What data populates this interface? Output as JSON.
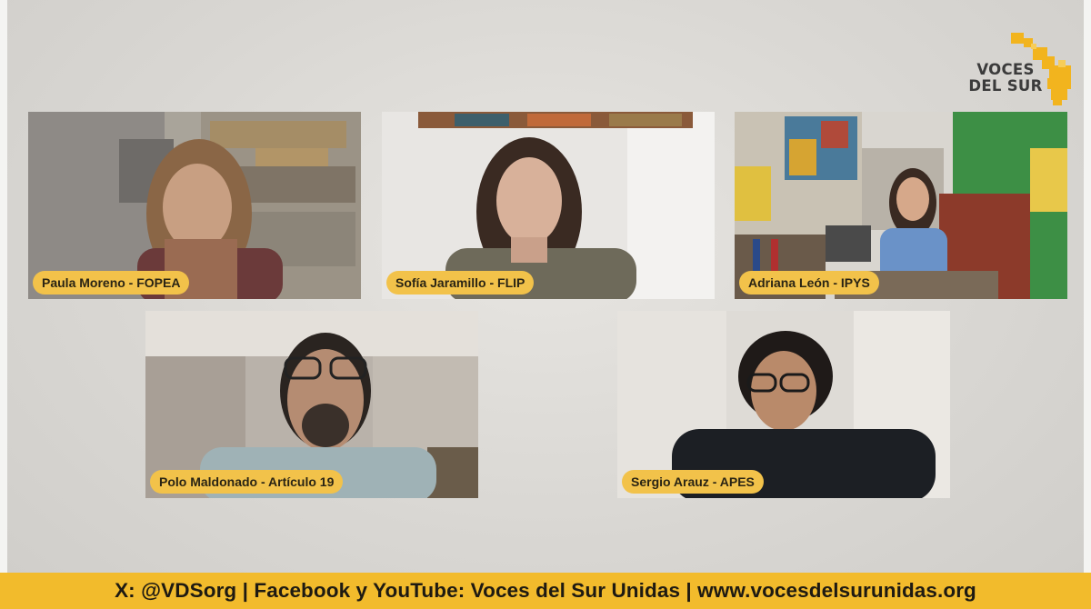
{
  "brand": {
    "logo_line1": "VOCES",
    "logo_line2": "DEL SUR",
    "accent_color": "#f2c24a",
    "footer_color": "#f2bb2c"
  },
  "participants": [
    {
      "label": "Paula Moreno - FOPEA"
    },
    {
      "label": "Sofía Jaramillo - FLIP"
    },
    {
      "label": "Adriana León - IPYS"
    },
    {
      "label": "Polo Maldonado - Artículo 19"
    },
    {
      "label": "Sergio Arauz - APES"
    }
  ],
  "footer": {
    "text": "X: @VDSorg | Facebook y YouTube: Voces del Sur Unidas | www.vocesdelsurunidas.org"
  }
}
